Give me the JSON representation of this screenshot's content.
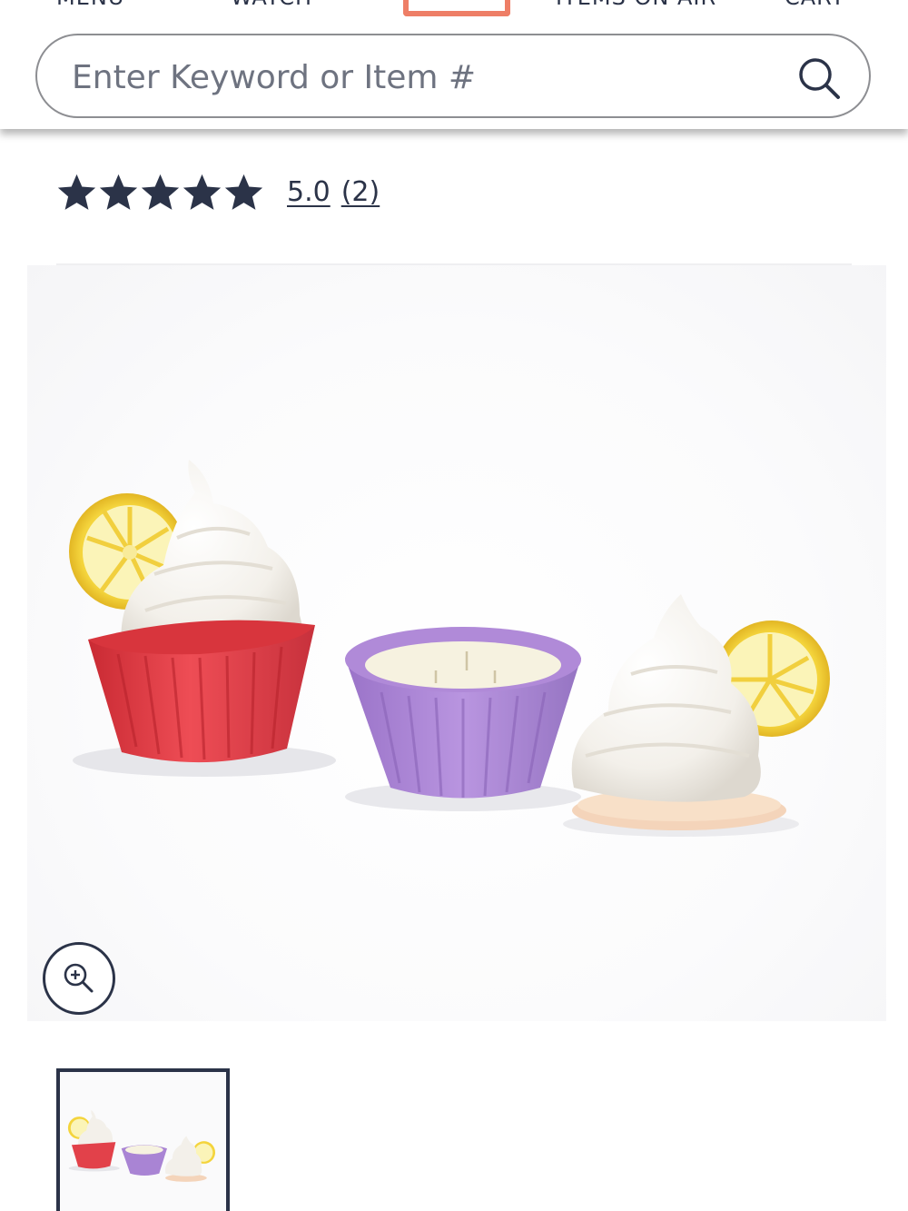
{
  "nav": {
    "items": [
      {
        "label": "MENU"
      },
      {
        "label": "WATCH"
      },
      {
        "label": "ITEMS ON AIR"
      },
      {
        "label": "CART"
      }
    ]
  },
  "search": {
    "placeholder": "Enter Keyword or Item #",
    "value": "",
    "icon": "search-icon"
  },
  "rating": {
    "stars": 5,
    "value": "5.0",
    "count": "(2)"
  },
  "product": {
    "image_icon": "product-image",
    "zoom_icon": "zoom-in-icon",
    "thumbnails_selected": 1
  },
  "colors": {
    "text": "#2b3348",
    "brand_accent": "#ee7e66",
    "search_border": "#8d8e92"
  }
}
